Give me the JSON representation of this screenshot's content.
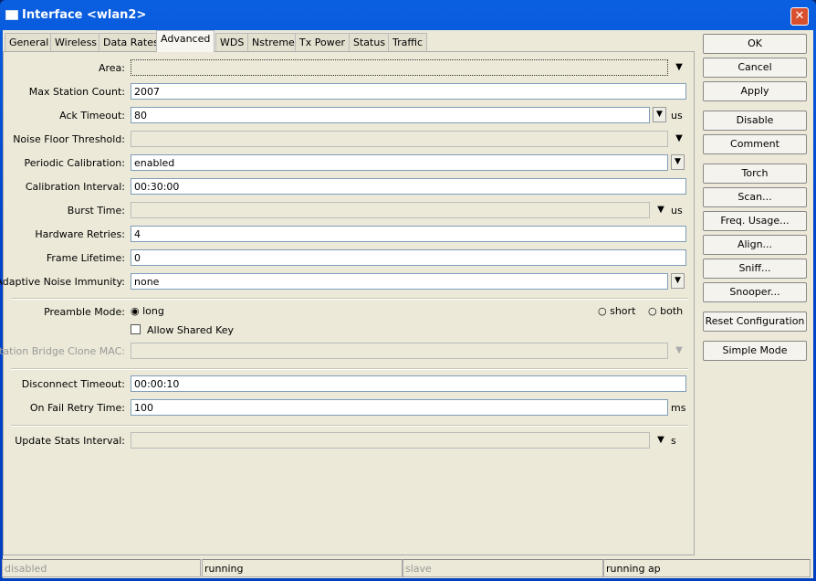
{
  "window": {
    "title": "Interface <wlan2>",
    "close_label": "✕"
  },
  "tabs": [
    "General",
    "Wireless",
    "Data Rates",
    "Advanced",
    "WDS",
    "Nstreme",
    "Tx Power",
    "Status",
    "Traffic"
  ],
  "fields": {
    "area": {
      "label": "Area:",
      "value": ""
    },
    "max_station_count": {
      "label": "Max Station Count:",
      "value": "2007"
    },
    "ack_timeout": {
      "label": "Ack Timeout:",
      "value": "80",
      "unit": "us"
    },
    "noise_floor_threshold": {
      "label": "Noise Floor Threshold:",
      "value": ""
    },
    "periodic_calibration": {
      "label": "Periodic Calibration:",
      "value": "enabled"
    },
    "calibration_interval": {
      "label": "Calibration Interval:",
      "value": "00:30:00"
    },
    "burst_time": {
      "label": "Burst Time:",
      "value": "",
      "unit": "us"
    },
    "hardware_retries": {
      "label": "Hardware Retries:",
      "value": "4"
    },
    "frame_lifetime": {
      "label": "Frame Lifetime:",
      "value": "0"
    },
    "adaptive_noise_immunity": {
      "label": "Adaptive Noise Immunity:",
      "value": "none"
    },
    "preamble_mode": {
      "label": "Preamble Mode:",
      "options": [
        "long",
        "short",
        "both"
      ],
      "selected": "long"
    },
    "allow_shared_key": {
      "label": "Allow Shared Key",
      "checked": false
    },
    "station_bridge_clone_mac": {
      "label": "Station Bridge Clone MAC:",
      "value": ""
    },
    "disconnect_timeout": {
      "label": "Disconnect Timeout:",
      "value": "00:00:10"
    },
    "on_fail_retry_time": {
      "label": "On Fail Retry Time:",
      "value": "100",
      "unit": "ms"
    },
    "update_stats_interval": {
      "label": "Update Stats Interval:",
      "value": "",
      "unit": "s"
    }
  },
  "buttons": [
    "OK",
    "Cancel",
    "Apply",
    "Disable",
    "Comment",
    "Torch",
    "Scan...",
    "Freq. Usage...",
    "Align...",
    "Sniff...",
    "Snooper...",
    "Reset Configuration",
    "Simple Mode"
  ],
  "status": [
    "disabled",
    "running",
    "slave",
    "running ap"
  ]
}
